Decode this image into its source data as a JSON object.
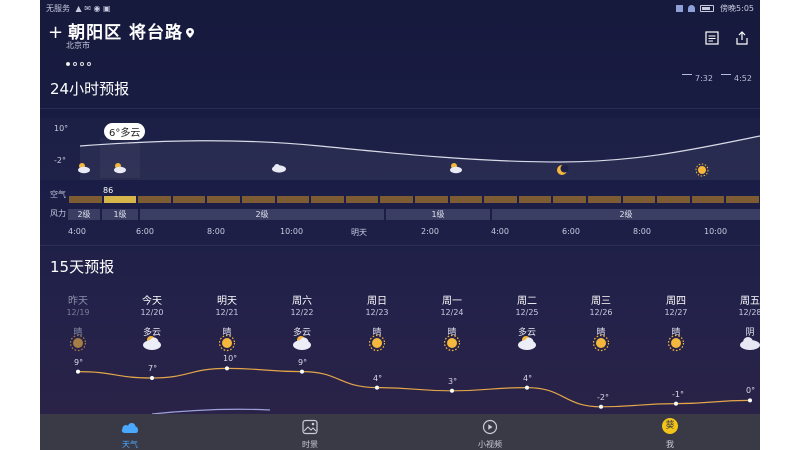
{
  "status_bar": {
    "carrier": "无服务",
    "carrier_icons": "▲ ✉ ◉ ▣",
    "time": "5:05",
    "extra": "傍晚"
  },
  "location": {
    "title": "朝阳区 将台路",
    "city": "北京市",
    "page_dots": 4,
    "active_dot": 0,
    "add_icon": "plus-icon",
    "pin_icon": "location-pin-icon"
  },
  "header_icons": [
    "news-icon",
    "share-icon"
  ],
  "hourly": {
    "title": "24小时预报",
    "sunrise": "7:32",
    "sunset": "4:52",
    "axis_max": "10°",
    "axis_min": "-2°",
    "tooltip": "6°多云",
    "aqi_label": "空气",
    "wind_label": "风力",
    "aqi_value": "86",
    "aqi_cells": 20,
    "aqi_highlight_index": 1,
    "wind_segments": [
      {
        "label": "2级"
      },
      {
        "label": "1级"
      },
      {
        "label": "2级"
      },
      {
        "label": "1级"
      },
      {
        "label": "2级"
      }
    ],
    "times": [
      "4:00",
      "6:00",
      "8:00",
      "10:00",
      "明天",
      "2:00",
      "4:00",
      "6:00",
      "8:00",
      "10:00"
    ],
    "icons": [
      "cloud-sun-icon",
      "cloud-sun-icon",
      "cloud-icon",
      "cloud-sun-icon",
      "moon-icon",
      "sun-icon"
    ]
  },
  "daily": {
    "title": "15天预报",
    "days": [
      {
        "name": "昨天",
        "date": "12/19",
        "cond": "晴",
        "icon": "sun-icon",
        "high": "9°",
        "past": true
      },
      {
        "name": "今天",
        "date": "12/20",
        "cond": "多云",
        "icon": "cloud-sun-icon",
        "high": "7°"
      },
      {
        "name": "明天",
        "date": "12/21",
        "cond": "晴",
        "icon": "sun-icon",
        "high": "10°"
      },
      {
        "name": "周六",
        "date": "12/22",
        "cond": "多云",
        "icon": "cloud-sun-icon",
        "high": "9°"
      },
      {
        "name": "周日",
        "date": "12/23",
        "cond": "晴",
        "icon": "sun-icon",
        "high": "4°"
      },
      {
        "name": "周一",
        "date": "12/24",
        "cond": "晴",
        "icon": "sun-icon",
        "high": "3°"
      },
      {
        "name": "周二",
        "date": "12/25",
        "cond": "多云",
        "icon": "cloud-sun-icon",
        "high": "4°"
      },
      {
        "name": "周三",
        "date": "12/26",
        "cond": "晴",
        "icon": "sun-icon",
        "high": "-2°"
      },
      {
        "name": "周四",
        "date": "12/27",
        "cond": "晴",
        "icon": "sun-icon",
        "high": "-1°"
      },
      {
        "name": "周五",
        "date": "12/28",
        "cond": "阴",
        "icon": "cloud-icon",
        "high": "0°"
      }
    ]
  },
  "bottom_nav": [
    {
      "label": "天气",
      "icon": "cloud-icon",
      "active": true
    },
    {
      "label": "时景",
      "icon": "image-icon"
    },
    {
      "label": "小视频",
      "icon": "play-icon"
    },
    {
      "label": "我",
      "icon": "avatar-icon",
      "badge": "葵"
    }
  ],
  "colors": {
    "background": "#1a1d45",
    "accent": "#4aa8ff",
    "sun": "#f5b83d",
    "aqi_good": "#7d5c33",
    "aqi_highlight": "#d6b64a",
    "high_line": "#e2a54a",
    "low_line": "#9aa0d8"
  }
}
